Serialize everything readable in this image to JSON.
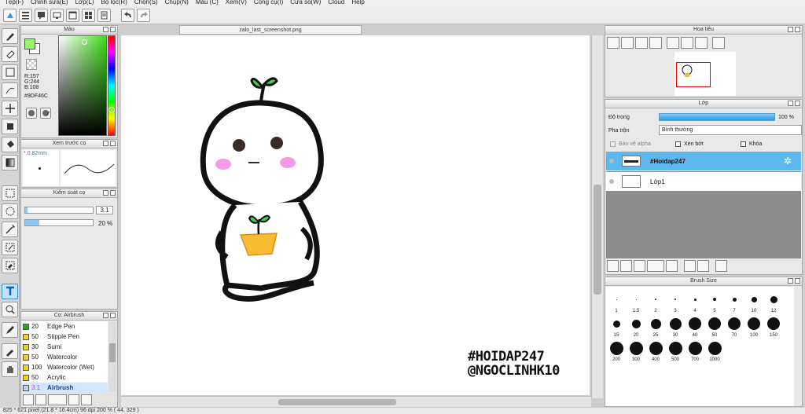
{
  "menu": [
    "Tệp(F)",
    "Chỉnh sửa(E)",
    "Lớp(L)",
    "Bộ lọc(R)",
    "Chọn(S)",
    "Chụp(N)",
    "Màu (C)",
    "Xem(V)",
    "Công cụ(I)",
    "Cửa sổ(W)",
    "Cloud",
    "Help"
  ],
  "color_panel": {
    "title": "Màu",
    "r": "R:157",
    "g": "G:244",
    "b": "B:108",
    "hex": "#9DF46C",
    "fg": "#9DF46C"
  },
  "brush_preview": {
    "title": "Xem trước cọ",
    "size": "* 0.82mm"
  },
  "brush_control": {
    "title": "Kiểm soát cọ",
    "size_value": "3.1",
    "opacity_value": "20 %"
  },
  "brush_list": {
    "title": "Cọ: Airbrush",
    "items": [
      {
        "size": "20",
        "name": "Edge Pen",
        "color": "#22aa22"
      },
      {
        "size": "50",
        "name": "Stipple Pen",
        "color": "#f0d020"
      },
      {
        "size": "30",
        "name": "Sumi",
        "color": "#f0d020"
      },
      {
        "size": "50",
        "name": "Watercolor",
        "color": "#f0d020"
      },
      {
        "size": "100",
        "name": "Watercolor (Wet)",
        "color": "#f0d020"
      },
      {
        "size": "50",
        "name": "Acrylic",
        "color": "#f0d020"
      },
      {
        "size": "3.1",
        "name": "Airbrush",
        "color": "#d0d0d0"
      }
    ]
  },
  "document": {
    "tab": "zalo_last_screenshot.png"
  },
  "artwork": {
    "text_line1": "#HOIDAP247",
    "text_line2": "@NGOCLINHK10"
  },
  "status": "825 * 621 pixel  (21.8 * 16.4cm)  96 dpi  200 %  ( 44, 329 )",
  "navigator": {
    "title": "Hoa tiêu"
  },
  "layers": {
    "title": "Lớp",
    "opacity_label": "Độ trong",
    "opacity_value": "100 %",
    "blend_label": "Pha trộn",
    "blend_value": "Bình thường",
    "alpha_label": "Bảo vệ alpha",
    "clip_label": "Xén bớt",
    "lock_label": "Khóa",
    "items": [
      {
        "name": "#Hoidap247",
        "selected": true
      },
      {
        "name": "Lớp1",
        "selected": false
      }
    ]
  },
  "brush_size": {
    "title": "Brush Size",
    "row1": [
      "1",
      "1.5",
      "2",
      "3",
      "4",
      "5",
      "7",
      "10",
      "12"
    ],
    "row2": [
      "15",
      "20",
      "25",
      "30",
      "40",
      "50",
      "70",
      "100",
      "150"
    ],
    "row3": [
      "200",
      "300",
      "400",
      "500",
      "700",
      "1000"
    ]
  }
}
